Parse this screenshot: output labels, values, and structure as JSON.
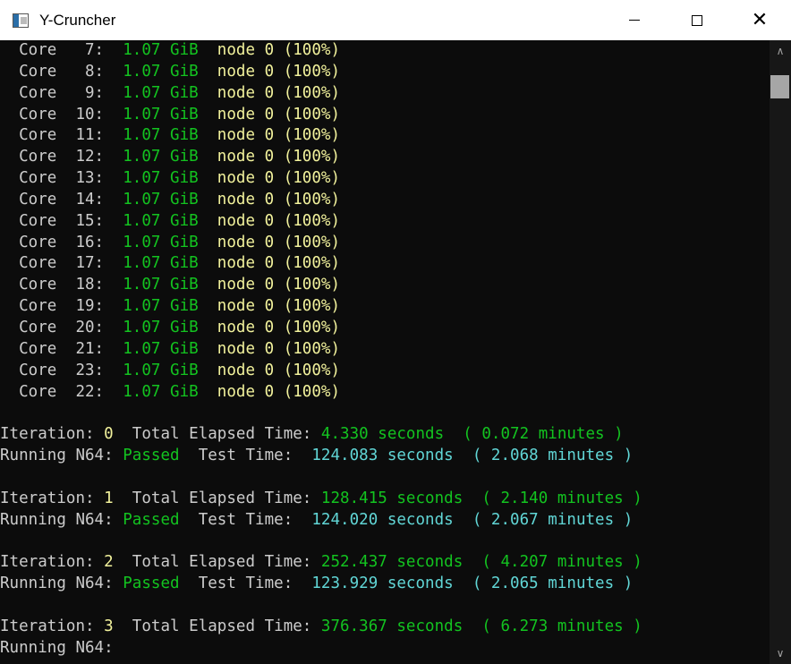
{
  "window": {
    "title": "Y-Cruncher",
    "controls": {
      "minimize": "minimize",
      "maximize": "maximize",
      "close": "✕"
    }
  },
  "scrollbar": {
    "up": "∧",
    "down": "∨"
  },
  "colors": {
    "white": "#cccccc",
    "green": "#13c320",
    "yellow": "#f2f29c",
    "cyan": "#61d6d6",
    "background": "#0c0c0c"
  },
  "console": {
    "cores": [
      {
        "label": "  Core   7:  ",
        "mem": "1.07 GiB",
        "node": "  node 0 (100%)"
      },
      {
        "label": "  Core   8:  ",
        "mem": "1.07 GiB",
        "node": "  node 0 (100%)"
      },
      {
        "label": "  Core   9:  ",
        "mem": "1.07 GiB",
        "node": "  node 0 (100%)"
      },
      {
        "label": "  Core  10:  ",
        "mem": "1.07 GiB",
        "node": "  node 0 (100%)"
      },
      {
        "label": "  Core  11:  ",
        "mem": "1.07 GiB",
        "node": "  node 0 (100%)"
      },
      {
        "label": "  Core  12:  ",
        "mem": "1.07 GiB",
        "node": "  node 0 (100%)"
      },
      {
        "label": "  Core  13:  ",
        "mem": "1.07 GiB",
        "node": "  node 0 (100%)"
      },
      {
        "label": "  Core  14:  ",
        "mem": "1.07 GiB",
        "node": "  node 0 (100%)"
      },
      {
        "label": "  Core  15:  ",
        "mem": "1.07 GiB",
        "node": "  node 0 (100%)"
      },
      {
        "label": "  Core  16:  ",
        "mem": "1.07 GiB",
        "node": "  node 0 (100%)"
      },
      {
        "label": "  Core  17:  ",
        "mem": "1.07 GiB",
        "node": "  node 0 (100%)"
      },
      {
        "label": "  Core  18:  ",
        "mem": "1.07 GiB",
        "node": "  node 0 (100%)"
      },
      {
        "label": "  Core  19:  ",
        "mem": "1.07 GiB",
        "node": "  node 0 (100%)"
      },
      {
        "label": "  Core  20:  ",
        "mem": "1.07 GiB",
        "node": "  node 0 (100%)"
      },
      {
        "label": "  Core  21:  ",
        "mem": "1.07 GiB",
        "node": "  node 0 (100%)"
      },
      {
        "label": "  Core  23:  ",
        "mem": "1.07 GiB",
        "node": "  node 0 (100%)"
      },
      {
        "label": "  Core  22:  ",
        "mem": "1.07 GiB",
        "node": "  node 0 (100%)"
      }
    ],
    "iterations": [
      {
        "label": "Iteration: ",
        "number": "0",
        "elapsed_label": "  Total Elapsed Time: ",
        "elapsed": "4.330 seconds  ( 0.072 minutes )",
        "running": "Running N64: ",
        "status": "Passed",
        "test_label": "  Test Time:  ",
        "test_time": "124.083 seconds  ( 2.068 minutes )"
      },
      {
        "label": "Iteration: ",
        "number": "1",
        "elapsed_label": "  Total Elapsed Time: ",
        "elapsed": "128.415 seconds  ( 2.140 minutes )",
        "running": "Running N64: ",
        "status": "Passed",
        "test_label": "  Test Time:  ",
        "test_time": "124.020 seconds  ( 2.067 minutes )"
      },
      {
        "label": "Iteration: ",
        "number": "2",
        "elapsed_label": "  Total Elapsed Time: ",
        "elapsed": "252.437 seconds  ( 4.207 minutes )",
        "running": "Running N64: ",
        "status": "Passed",
        "test_label": "  Test Time:  ",
        "test_time": "123.929 seconds  ( 2.065 minutes )"
      }
    ],
    "last_iteration": {
      "label": "Iteration: ",
      "number": "3",
      "elapsed_label": "  Total Elapsed Time: ",
      "elapsed": "376.367 seconds  ( 6.273 minutes )",
      "running": "Running N64:"
    }
  }
}
